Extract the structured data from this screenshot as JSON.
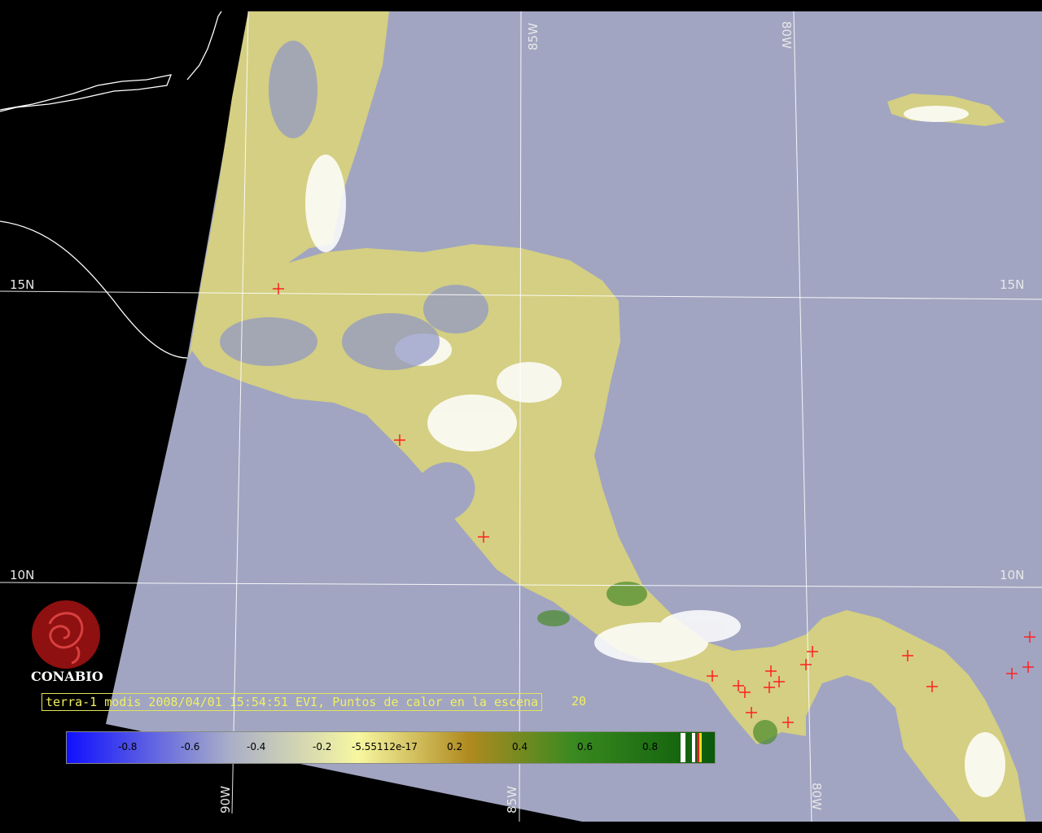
{
  "grid_labels": {
    "lat_15": "15N",
    "lat_10": "10N",
    "lon_90": "90W",
    "lon_85": "85W",
    "lon_80": "80W"
  },
  "caption": {
    "text": "terra-1 modis 2008/04/01 15:54:51 EVI, Puntos de calor en la escena",
    "count": "20"
  },
  "legend": {
    "ticks": [
      "-0.8",
      "-0.6",
      "-0.4",
      "-0.2",
      "-5.55112e-17",
      "0.2",
      "0.4",
      "0.6",
      "0.8"
    ],
    "colors": {
      "low": "#1010ff",
      "mid_low": "#a8aec8",
      "neutral": "#f7f7a0",
      "mid_high": "#b08a20",
      "high": "#0a5a0a"
    }
  },
  "logo": {
    "text": "CONABIO",
    "color": "#8e1010"
  },
  "map_colors": {
    "ocean": "#a1a5c1",
    "outside": "#000000",
    "land": "#d4cf82",
    "grid": "#ffffff",
    "hotspot": "#ff2020"
  },
  "hotspots": {
    "count": "20",
    "symbol": "red-cross"
  }
}
